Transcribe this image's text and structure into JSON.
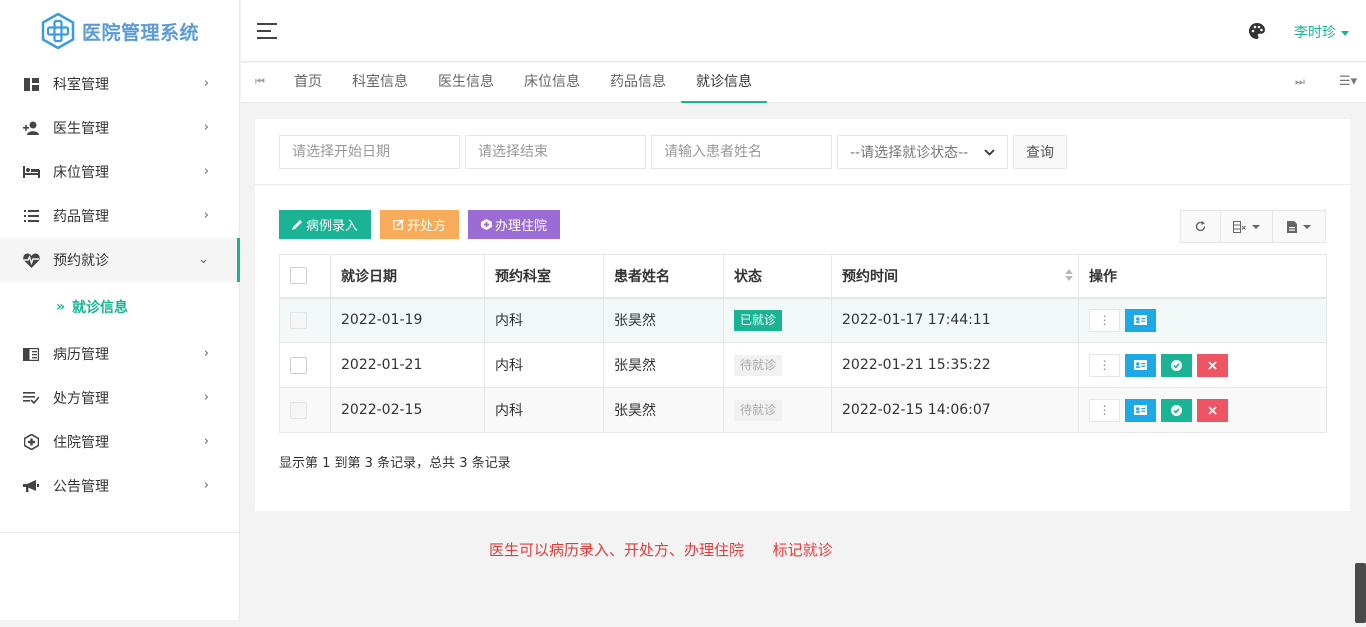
{
  "app": {
    "title": "医院管理系统"
  },
  "user": {
    "name": "李时珍"
  },
  "sidebar": {
    "items": [
      {
        "label": "科室管理",
        "icon": "dashboard-icon"
      },
      {
        "label": "医生管理",
        "icon": "add-user-icon"
      },
      {
        "label": "床位管理",
        "icon": "bed-icon"
      },
      {
        "label": "药品管理",
        "icon": "list-icon"
      },
      {
        "label": "预约就诊",
        "icon": "heartbeat-icon"
      },
      {
        "label": "病历管理",
        "icon": "record-icon"
      },
      {
        "label": "处方管理",
        "icon": "prescription-icon"
      },
      {
        "label": "住院管理",
        "icon": "hospital-icon"
      },
      {
        "label": "公告管理",
        "icon": "bullhorn-icon"
      }
    ],
    "sub_item": {
      "prefix": "»",
      "label": "就诊信息"
    }
  },
  "tabs": [
    "首页",
    "科室信息",
    "医生信息",
    "床位信息",
    "药品信息",
    "就诊信息"
  ],
  "search": {
    "start_date_placeholder": "请选择开始日期",
    "end_date_placeholder": "请选择结束",
    "patient_placeholder": "请输入患者姓名",
    "status_select": "--请选择就诊状态--",
    "query_label": "查询"
  },
  "actions": {
    "record_label": "病例录入",
    "prescribe_label": "开处方",
    "admit_label": "办理住院"
  },
  "table": {
    "columns": [
      "就诊日期",
      "预约科室",
      "患者姓名",
      "状态",
      "预约时间",
      "操作"
    ],
    "rows": [
      {
        "date": "2022-01-19",
        "dept": "内科",
        "patient": "张昊然",
        "status": "已就诊",
        "time": "2022-01-17 17:44:11"
      },
      {
        "date": "2022-01-21",
        "dept": "内科",
        "patient": "张昊然",
        "status": "待就诊",
        "time": "2022-01-21 15:35:22"
      },
      {
        "date": "2022-02-15",
        "dept": "内科",
        "patient": "张昊然",
        "status": "待就诊",
        "time": "2022-02-15 14:06:07"
      }
    ]
  },
  "pagination_info": "显示第 1 到第 3 条记录，总共 3 条记录",
  "annotation": "医生可以病历录入、开处方、办理住院      标记就诊",
  "colors": {
    "accent": "#1ab394",
    "orange": "#f8ac59",
    "purple": "#9b6cd4",
    "info": "#1da9e5",
    "danger": "#ed5565",
    "annotation": "#e23b3b"
  }
}
